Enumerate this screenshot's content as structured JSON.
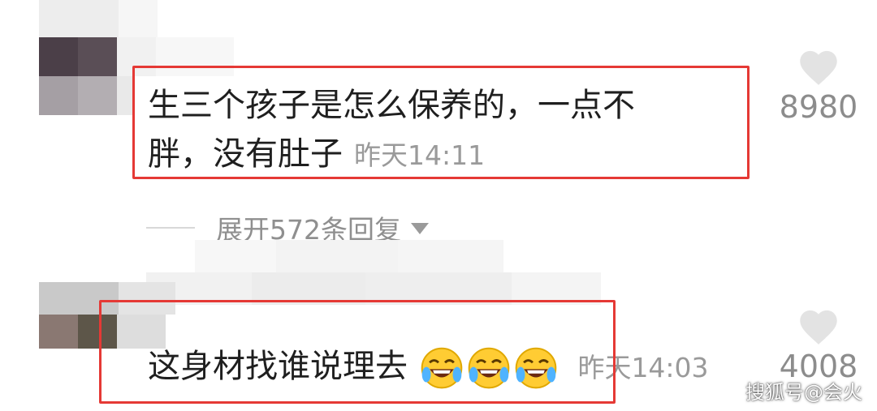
{
  "comments": [
    {
      "text_line1": "生三个孩子是怎么保养的，一点不",
      "text_line2": "胖，没有肚子",
      "time": "昨天14:11",
      "likes": "8980"
    },
    {
      "text_line1": "这身材找谁说理去",
      "time": "昨天14:03",
      "likes": "4008",
      "emoji_icon": "laughing-tears-emoji",
      "emoji_count": 3
    }
  ],
  "expand_replies": {
    "label": "展开572条回复"
  },
  "watermark": {
    "text": "搜狐号@会火"
  },
  "colors": {
    "highlight_border": "#e53935",
    "text": "#1f1f1f",
    "secondary_text": "#9a9a9a",
    "heart": "#e3e3e3"
  }
}
